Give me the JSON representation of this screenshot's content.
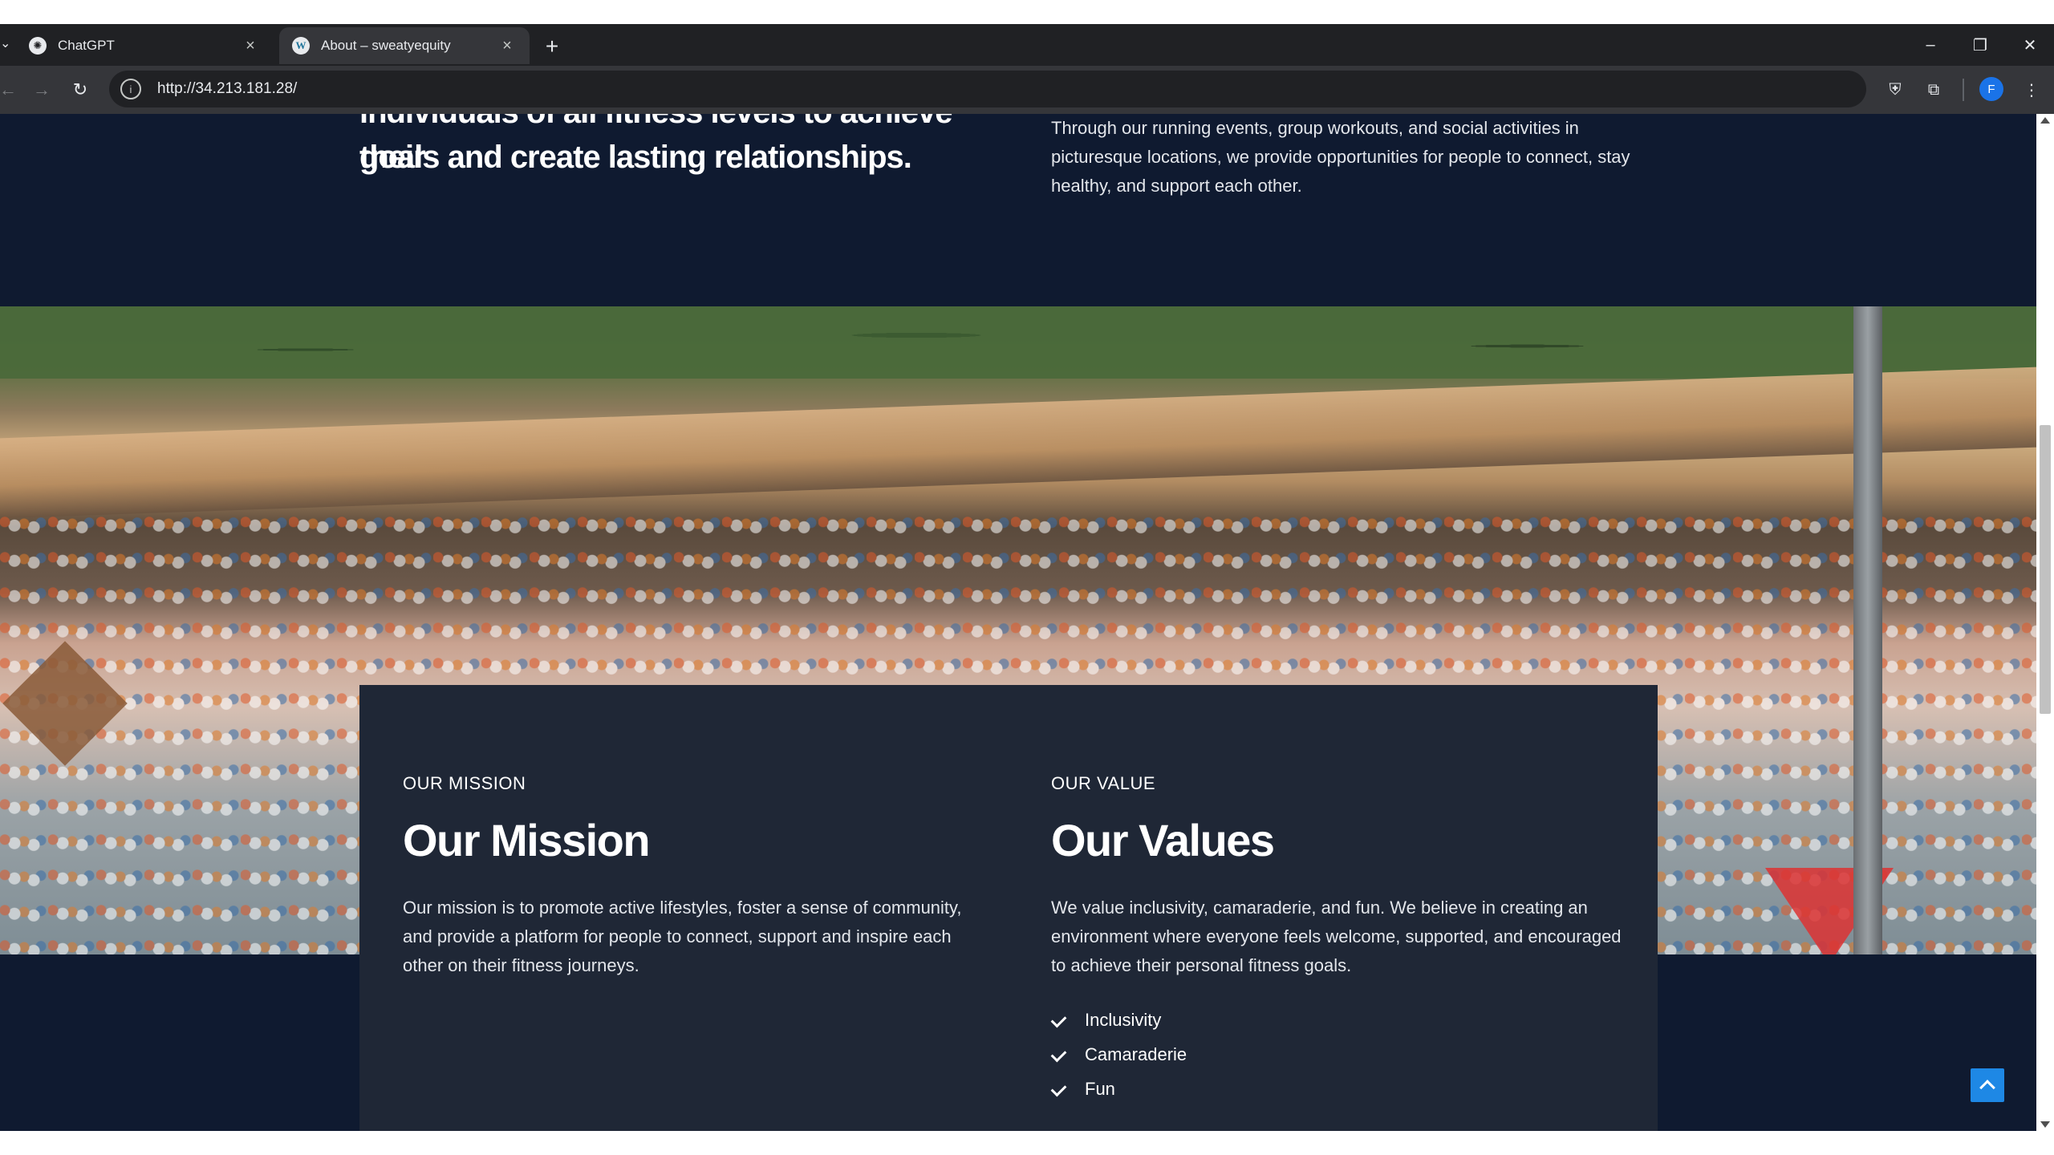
{
  "browser": {
    "tabs": [
      {
        "title": "ChatGPT",
        "favicon": "chatgpt-icon",
        "active": false
      },
      {
        "title": "About – sweatyequity",
        "favicon": "wordpress-icon",
        "active": true
      }
    ],
    "url": "http://34.213.181.28/",
    "profile_initial": "F",
    "colors": {
      "chrome": "#202124",
      "toolbar": "#35363a",
      "accent": "#1a73e8"
    }
  },
  "page": {
    "intro": {
      "heading_line1": "individuals of all fitness levels to achieve their",
      "heading_line2": "goals and create lasting relationships.",
      "text": "Through our running events, group workouts, and social activities in picturesque locations, we provide opportunities for people to connect, stay healthy, and support each other."
    },
    "mission": {
      "eyebrow": "OUR MISSION",
      "heading": "Our Mission",
      "text": "Our mission is to promote active lifestyles, foster a sense of community, and provide a platform for people to connect, support and inspire each other on their fitness journeys."
    },
    "values": {
      "eyebrow": "OUR VALUE",
      "heading": "Our Values",
      "text": "We value inclusivity, camaraderie, and fun. We believe in creating an environment where everyone feels welcome, supported, and encouraged to achieve their personal fitness goals.",
      "items": [
        "Inclusivity",
        "Camaraderie",
        "Fun"
      ]
    },
    "colors": {
      "background": "#0f1a30",
      "card": "#1f2736",
      "scroll_top": "#1e88e5"
    }
  }
}
